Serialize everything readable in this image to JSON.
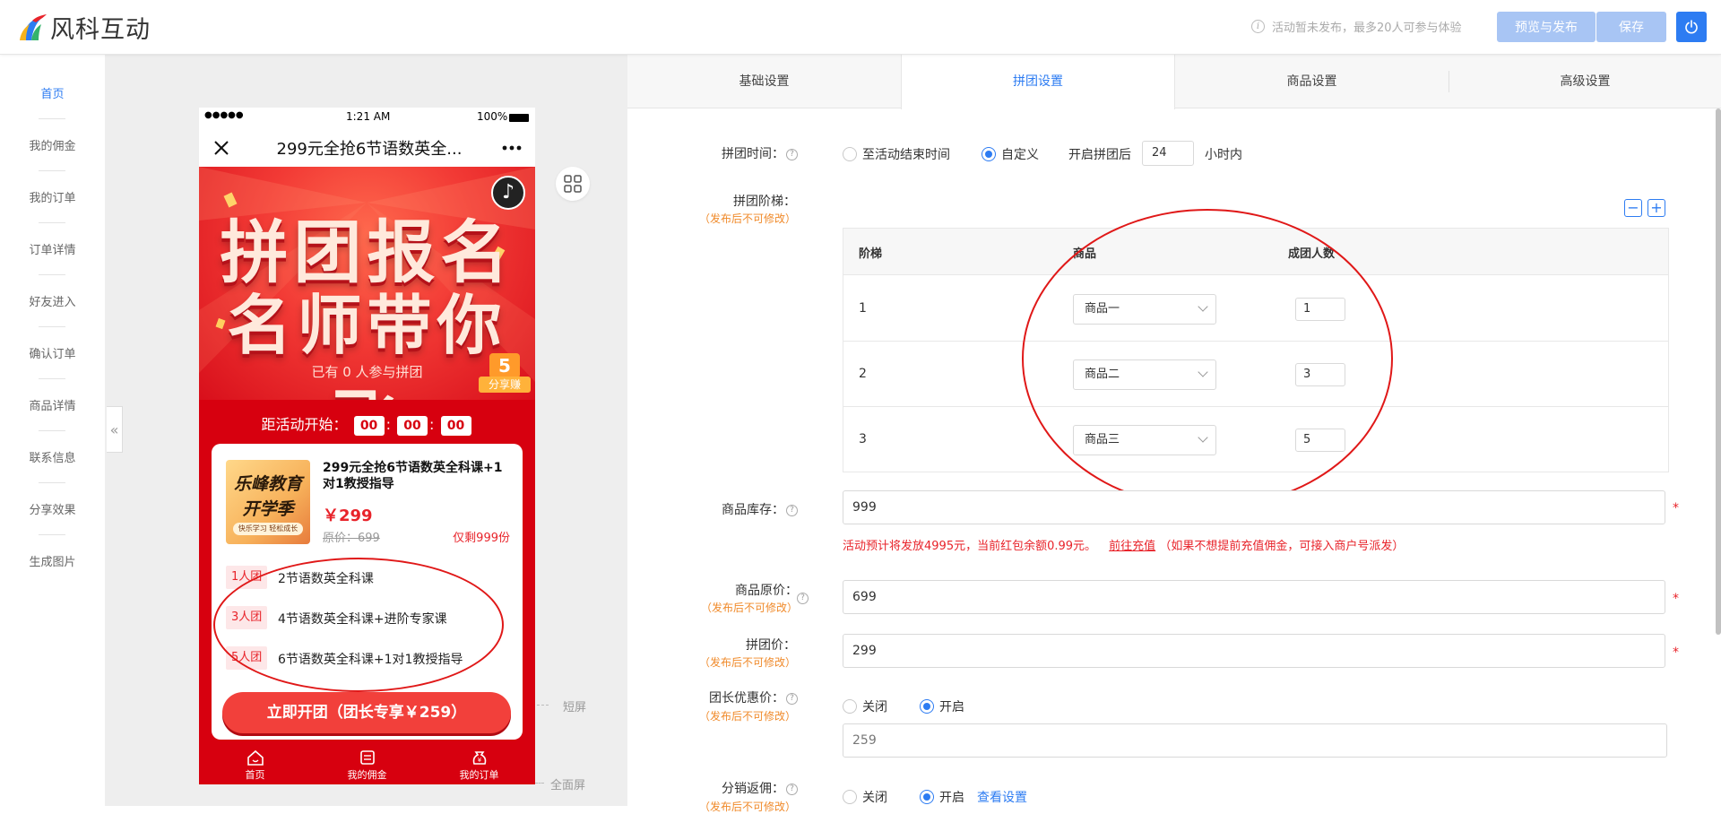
{
  "header": {
    "logo_text": "风科互动",
    "tip": "活动暂未发布，最多20人可参与体验",
    "preview_publish_label": "预览与发布",
    "save_label": "保存",
    "accent": "#2d7cf2"
  },
  "sidebar": {
    "items": [
      {
        "label": "首页",
        "active": true
      },
      {
        "label": "我的佣金"
      },
      {
        "label": "我的订单"
      },
      {
        "label": "订单详情"
      },
      {
        "label": "好友进入"
      },
      {
        "label": "确认订单"
      },
      {
        "label": "商品详情"
      },
      {
        "label": "联系信息"
      },
      {
        "label": "分享效果"
      },
      {
        "label": "生成图片"
      }
    ],
    "collapse_glyph": "«"
  },
  "preview": {
    "status": {
      "signal": "●●●●●",
      "time": "1:21 AM",
      "battery": "100%"
    },
    "nav_title": "299元全抢6节语数英全...",
    "banner_line1": "拼团报名",
    "banner_line2": "名师带你飞",
    "joined_text": "已有 0 人参与拼团",
    "share_badge": {
      "num": "5",
      "label": "分享赚"
    },
    "countdown_label": "距活动开始：",
    "countdown": [
      "00",
      "00",
      "00"
    ],
    "product": {
      "thumb_line1": "乐峰教育",
      "thumb_line2": "开学季",
      "thumb_tagline": "快乐学习 轻松成长",
      "name": "299元全抢6节语数英全科课+1对1教授指导",
      "price": "￥299",
      "original_price": "原价：699",
      "stock_left": "仅剩999份"
    },
    "tiers": [
      {
        "tag": "1人团",
        "text": "2节语数英全科课"
      },
      {
        "tag": "3人团",
        "text": "4节语数英全科课+进阶专家课"
      },
      {
        "tag": "5人团",
        "text": "6节语数英全科课+1对1教授指导"
      }
    ],
    "cta_label": "立即开团（团长专享￥259）",
    "tabbar": [
      {
        "label": "首页"
      },
      {
        "label": "我的佣金"
      },
      {
        "label": "我的订单"
      }
    ],
    "short_screen": "短屏",
    "full_screen": "全面屏"
  },
  "tabs": [
    {
      "label": "基础设置"
    },
    {
      "label": "拼团设置",
      "active": true
    },
    {
      "label": "商品设置"
    },
    {
      "label": "高级设置"
    }
  ],
  "form": {
    "group_time": {
      "label": "拼团时间：",
      "opt_end": "至活动结束时间",
      "opt_custom": "自定义",
      "prefix": "开启拼团后",
      "hours": "24",
      "suffix": "小时内"
    },
    "ladder": {
      "label": "拼团阶梯：",
      "note": "（发布后不可修改）",
      "minus": "−",
      "plus": "+",
      "headers": [
        "阶梯",
        "商品",
        "成团人数"
      ],
      "rows": [
        {
          "idx": "1",
          "product": "商品一",
          "count": "1"
        },
        {
          "idx": "2",
          "product": "商品二",
          "count": "3"
        },
        {
          "idx": "3",
          "product": "商品三",
          "count": "5"
        }
      ]
    },
    "stock": {
      "label": "商品库存：",
      "value": "999"
    },
    "warning": {
      "text": "活动预计将发放4995元，当前红包余额0.99元。",
      "link": "前往充值",
      "tail": "（如果不想提前充值佣金，可接入商户号派发）"
    },
    "orig_price": {
      "label": "商品原价：",
      "note": "（发布后不可修改）",
      "value": "699"
    },
    "group_price": {
      "label": "拼团价：",
      "note": "（发布后不可修改）",
      "value": "299"
    },
    "leader_discount": {
      "label": "团长优惠价：",
      "note": "（发布后不可修改）",
      "off": "关闭",
      "on": "开启",
      "value": "259"
    },
    "distribution": {
      "label": "分销返佣：",
      "note": "（发布后不可修改）",
      "off": "关闭",
      "on": "开启",
      "link": "查看设置"
    },
    "required_mark": "*"
  }
}
